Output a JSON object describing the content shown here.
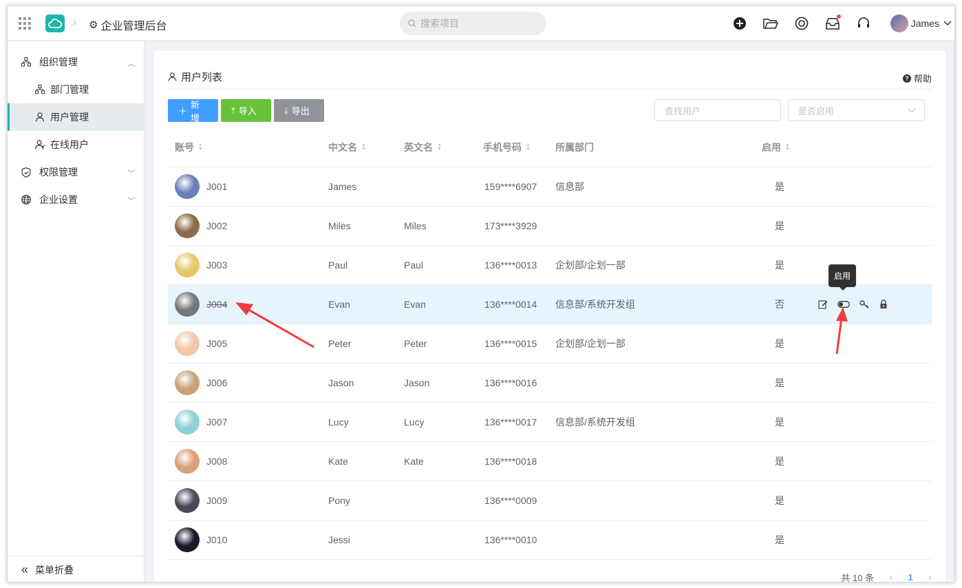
{
  "header": {
    "app_title": "企业管理后台",
    "search_placeholder": "搜索项目",
    "user_name": "James"
  },
  "sidebar": {
    "groups": [
      {
        "label": "组织管理",
        "icon": "org-icon",
        "expanded": true
      },
      {
        "label": "权限管理",
        "icon": "shield-icon",
        "expanded": false
      },
      {
        "label": "企业设置",
        "icon": "globe-icon",
        "expanded": false
      }
    ],
    "sub_items": [
      {
        "label": "部门管理",
        "icon": "org-icon"
      },
      {
        "label": "用户管理",
        "icon": "user-icon",
        "active": true
      },
      {
        "label": "在线用户",
        "icon": "user-online-icon"
      }
    ],
    "collapse_label": "菜单折叠"
  },
  "panel": {
    "title": "用户列表",
    "help_label": "帮助"
  },
  "toolbar": {
    "add_label": "新增",
    "import_label": "导入",
    "export_label": "导出"
  },
  "filters": {
    "search_placeholder": "查找用户",
    "enabled_placeholder": "是否启用"
  },
  "table": {
    "columns": [
      "账号",
      "中文名",
      "英文名",
      "手机号码",
      "所属部门",
      "启用"
    ],
    "rows": [
      {
        "account": "J001",
        "cn_name": "James",
        "en_name": "",
        "phone": "159****6907",
        "dept": "信息部",
        "enabled": "是",
        "avatar_color": "#6a7fb5"
      },
      {
        "account": "J002",
        "cn_name": "Miles",
        "en_name": "Miles",
        "phone": "173****3929",
        "dept": "",
        "enabled": "是",
        "avatar_color": "#8b6b4a"
      },
      {
        "account": "J003",
        "cn_name": "Paul",
        "en_name": "Paul",
        "phone": "136****0013",
        "dept": "企划部/企划一部",
        "enabled": "是",
        "avatar_color": "#e8c76a"
      },
      {
        "account": "J004",
        "cn_name": "Evan",
        "en_name": "Evan",
        "phone": "136****0014",
        "dept": "信息部/系统开发组",
        "enabled": "否",
        "avatar_color": "#777777"
      },
      {
        "account": "J005",
        "cn_name": "Peter",
        "en_name": "Peter",
        "phone": "136****0015",
        "dept": "企划部/企划一部",
        "enabled": "是",
        "avatar_color": "#f2c7a8"
      },
      {
        "account": "J006",
        "cn_name": "Jason",
        "en_name": "Jason",
        "phone": "136****0016",
        "dept": "",
        "enabled": "是",
        "avatar_color": "#c9a27a"
      },
      {
        "account": "J007",
        "cn_name": "Lucy",
        "en_name": "Lucy",
        "phone": "136****0017",
        "dept": "信息部/系统开发组",
        "enabled": "是",
        "avatar_color": "#8fd0d8"
      },
      {
        "account": "J008",
        "cn_name": "Kate",
        "en_name": "Kate",
        "phone": "136****0018",
        "dept": "",
        "enabled": "是",
        "avatar_color": "#d9a07a"
      },
      {
        "account": "J009",
        "cn_name": "Pony",
        "en_name": "",
        "phone": "136****0009",
        "dept": "",
        "enabled": "是",
        "avatar_color": "#4a4a5a"
      },
      {
        "account": "J010",
        "cn_name": "Jessi",
        "en_name": "",
        "phone": "136****0010",
        "dept": "",
        "enabled": "是",
        "avatar_color": "#1a1a2e"
      }
    ]
  },
  "tooltip": "启用",
  "pagination": {
    "total_label": "共 10 条",
    "current_page": "1"
  },
  "colors": {
    "accent": "#1fb5a8",
    "primary": "#409eff",
    "success": "#67c23a",
    "info": "#909399",
    "annotation": "#f03c3c"
  }
}
